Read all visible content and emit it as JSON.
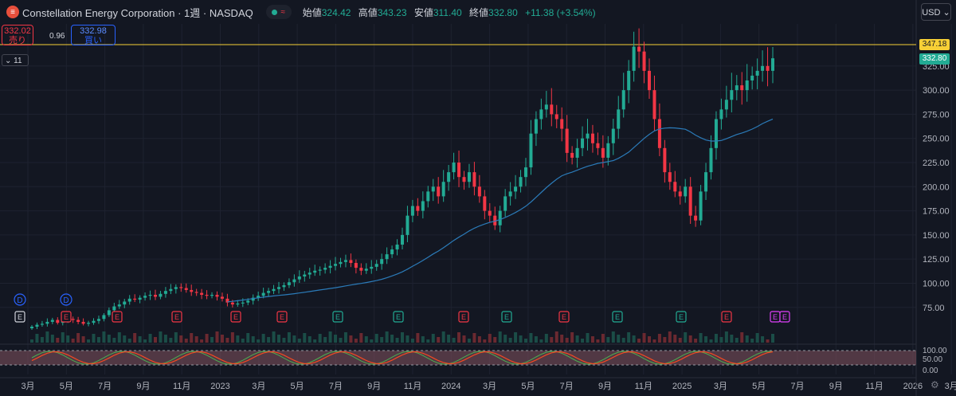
{
  "header": {
    "title": "Constellation Energy Corporation · 1週 · NASDAQ",
    "ohlc": {
      "open_label": "始値",
      "open": "324.42",
      "high_label": "高値",
      "high": "343.23",
      "low_label": "安値",
      "low": "311.40",
      "close_label": "終値",
      "close": "332.80",
      "change": "+11.38 (+3.54%)"
    }
  },
  "trade": {
    "sell_price": "332.02",
    "sell_label": "売り",
    "spread": "0.96",
    "buy_price": "332.98",
    "buy_label": "買い"
  },
  "indicator_toggle": "11",
  "currency": "USD",
  "price_tags": {
    "high": "347.18",
    "last": "332.80"
  },
  "price_axis": [
    "325.00",
    "300.00",
    "275.00",
    "250.00",
    "225.00",
    "200.00",
    "175.00",
    "150.00",
    "125.00",
    "100.00",
    "75.00"
  ],
  "osc_axis": [
    "100.00",
    "50.00",
    "0.00"
  ],
  "time_axis": [
    "3月",
    "5月",
    "7月",
    "9月",
    "11月",
    "2023",
    "3月",
    "5月",
    "7月",
    "9月",
    "11月",
    "2024",
    "3月",
    "5月",
    "7月",
    "9月",
    "11月",
    "2025",
    "3月",
    "5月",
    "7月",
    "9月",
    "11月",
    "2026",
    "3月"
  ],
  "markers_dividend": [
    "D",
    "D"
  ],
  "markers_earnings": [
    "E",
    "E",
    "E",
    "E",
    "E",
    "E",
    "E",
    "E",
    "E",
    "E",
    "E",
    "E",
    "E",
    "E",
    "E",
    "E"
  ],
  "colors": {
    "up": "#22ab94",
    "down": "#f23645",
    "ma": "#2b7bb9",
    "k": "#4caf50",
    "d": "#f44a22",
    "band": "#7b4f5c",
    "hiline": "#f7d036"
  },
  "chart_data": {
    "type": "candlestick",
    "title": "Constellation Energy Corporation · 1週 · NASDAQ",
    "ylim": [
      55,
      362
    ],
    "interval": "1週",
    "last": {
      "open": 324.42,
      "high": 343.23,
      "low": 311.4,
      "close": 332.8
    },
    "series": [
      {
        "name": "price_close_approx",
        "values": [
          55,
          57,
          58,
          60,
          62,
          59,
          61,
          63,
          62,
          60,
          58,
          59,
          61,
          63,
          67,
          72,
          76,
          78,
          81,
          84,
          83,
          85,
          87,
          88,
          86,
          89,
          92,
          94,
          96,
          95,
          93,
          91,
          90,
          88,
          87,
          88,
          86,
          84,
          80,
          78,
          79,
          80,
          82,
          85,
          87,
          90,
          92,
          94,
          96,
          98,
          101,
          104,
          107,
          109,
          111,
          113,
          114,
          116,
          118,
          120,
          122,
          124,
          121,
          116,
          113,
          115,
          117,
          120,
          125,
          130,
          135,
          140,
          150,
          170,
          180,
          175,
          185,
          195,
          200,
          190,
          205,
          215,
          225,
          210,
          205,
          215,
          200,
          190,
          175,
          170,
          160,
          175,
          190,
          195,
          200,
          210,
          220,
          255,
          270,
          280,
          285,
          275,
          270,
          260,
          235,
          230,
          240,
          250,
          255,
          245,
          240,
          230,
          245,
          260,
          280,
          300,
          320,
          345,
          340,
          320,
          300,
          270,
          240,
          215,
          205,
          195,
          190,
          200,
          170,
          165,
          195,
          215,
          240,
          270,
          280,
          290,
          300,
          305,
          300,
          310,
          315,
          320,
          325,
          320,
          333
        ]
      },
      {
        "name": "ma",
        "values": [
          null,
          null,
          null,
          null,
          null,
          null,
          null,
          null,
          null,
          null,
          null,
          null,
          null,
          null,
          null,
          null,
          null,
          null,
          null,
          null,
          null,
          null,
          null,
          null,
          null,
          null,
          null,
          null,
          null,
          null,
          null,
          null,
          null,
          null,
          null,
          null,
          null,
          null,
          null,
          null,
          null,
          null,
          null,
          null,
          null,
          null,
          null,
          null,
          null,
          null,
          null,
          null,
          null,
          null,
          null,
          null,
          null,
          null,
          null,
          null,
          null,
          null,
          null,
          null,
          null,
          null,
          null,
          null,
          null,
          null,
          null,
          null,
          null,
          null,
          null,
          null,
          null,
          null,
          null,
          null,
          null,
          null,
          null,
          null,
          null,
          null,
          null,
          null,
          null,
          null,
          null,
          null,
          null,
          null,
          null,
          null,
          null,
          null,
          null,
          null,
          null,
          null,
          null,
          null,
          null,
          null,
          null,
          null,
          null,
          null,
          null,
          null,
          null,
          null,
          null,
          null,
          null,
          null,
          null,
          null,
          null,
          null,
          null,
          null,
          null,
          null,
          null,
          null,
          null,
          null,
          null,
          null,
          null,
          null,
          null,
          null,
          null,
          null,
          null,
          null,
          null,
          null,
          null,
          null
        ]
      }
    ]
  }
}
